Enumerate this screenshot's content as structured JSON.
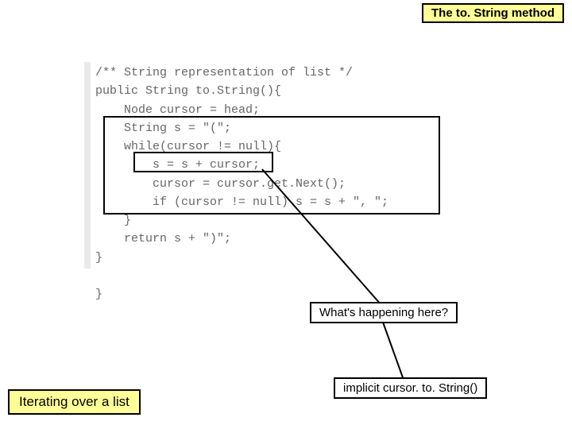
{
  "title": "The to. String method",
  "code": "/** String representation of list */\npublic String to.String(){\n    Node cursor = head;\n    String s = \"(\";\n    while(cursor != null){\n        s = s + cursor;\n        cursor = cursor.get.Next();\n        if (cursor != null) s = s + \", \";\n    }\n    return s + \")\";\n}\n\n}",
  "callout1": "What's happening here?",
  "callout2": "implicit cursor. to. String()",
  "footer": "Iterating over a list"
}
